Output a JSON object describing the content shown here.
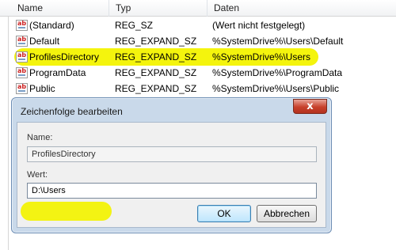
{
  "columns": {
    "name": "Name",
    "type": "Typ",
    "data": "Daten"
  },
  "rows": [
    {
      "name": "(Standard)",
      "type": "REG_SZ",
      "data": "(Wert nicht festgelegt)",
      "icon": "string-value-icon"
    },
    {
      "name": "Default",
      "type": "REG_EXPAND_SZ",
      "data": "%SystemDrive%\\Users\\Default",
      "icon": "string-value-icon"
    },
    {
      "name": "ProfilesDirectory",
      "type": "REG_EXPAND_SZ",
      "data": "%SystemDrive%\\Users",
      "icon": "string-value-icon",
      "highlighted": true
    },
    {
      "name": "ProgramData",
      "type": "REG_EXPAND_SZ",
      "data": "%SystemDrive%\\ProgramData",
      "icon": "string-value-icon"
    },
    {
      "name": "Public",
      "type": "REG_EXPAND_SZ",
      "data": "%SystemDrive%\\Users\\Public",
      "icon": "string-value-icon"
    }
  ],
  "dialog": {
    "title": "Zeichenfolge bearbeiten",
    "close_glyph": "x",
    "name_label": "Name:",
    "name_value": "ProfilesDirectory",
    "value_label": "Wert:",
    "value_value": "D:\\Users",
    "ok_label": "OK",
    "cancel_label": "Abbrechen"
  },
  "colors": {
    "highlight": "#f3f300",
    "close_button": "#c7402b",
    "dialog_frame": "#c9d9ea"
  }
}
